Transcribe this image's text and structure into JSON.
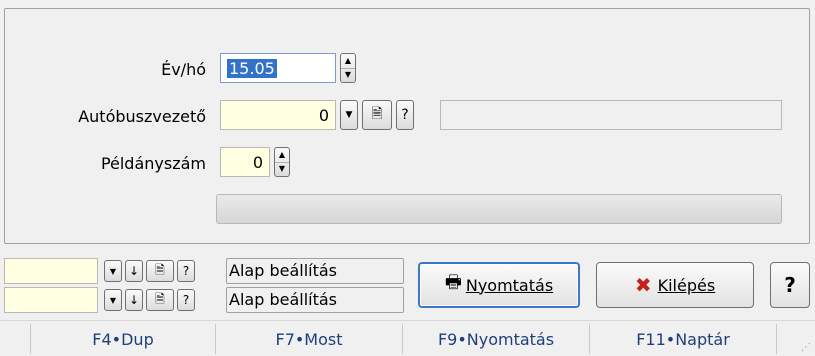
{
  "form": {
    "ev_ho": {
      "label": "Év/hó",
      "value": "15.05"
    },
    "autobuszvezeto": {
      "label": "Autóbuszvezető",
      "value": "0",
      "help_label": "?"
    },
    "peldanyszam": {
      "label": "Példányszám",
      "value": "0"
    },
    "progress": 0
  },
  "settings_rows": [
    {
      "help_label": "?",
      "label": "Alap beállítás"
    },
    {
      "help_label": "?",
      "label": "Alap beállítás"
    }
  ],
  "buttons": {
    "print_label": "Nyomtatás",
    "exit_label": "Kilépés",
    "help_label": "?"
  },
  "statusbar": [
    "F4•Dup",
    "F7•Most",
    "F9•Nyomtatás",
    "F11•Naptár"
  ]
}
